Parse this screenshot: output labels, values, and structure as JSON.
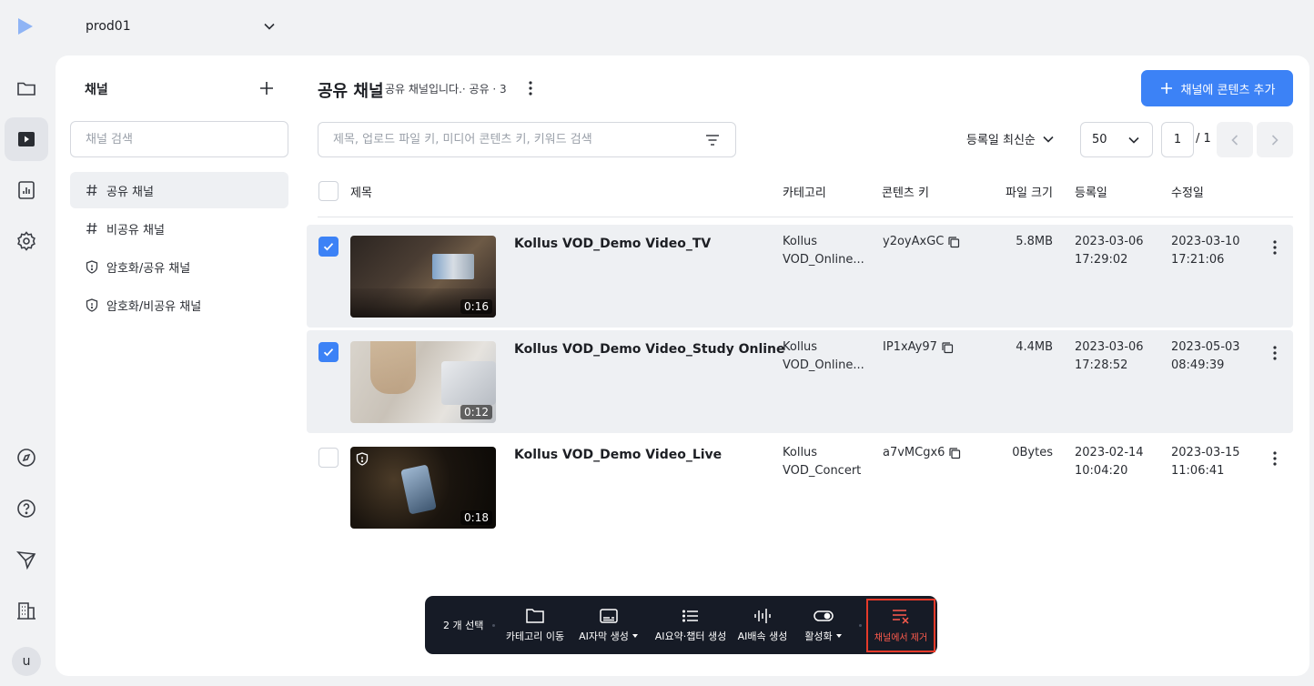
{
  "workspace": {
    "name": "prod01"
  },
  "sidebar": {
    "title": "채널",
    "search_placeholder": "채널 검색",
    "items": [
      {
        "label": "공유 채널",
        "icon": "hash-icon"
      },
      {
        "label": "비공유 채널",
        "icon": "hash-icon"
      },
      {
        "label": "암호화/공유 채널",
        "icon": "shield-icon"
      },
      {
        "label": "암호화/비공유 채널",
        "icon": "shield-icon"
      }
    ]
  },
  "header": {
    "title": "공유 채널",
    "subtitle": "공유 채널입니다.· 공유 · 3",
    "add_button": "채널에 콘텐츠 추가"
  },
  "toolbar": {
    "search_placeholder": "제목, 업로드 파일 키, 미디어 콘텐츠 키, 키워드 검색",
    "sort_label": "등록일 최신순",
    "per_page": "50",
    "page": "1",
    "page_total": "/ 1"
  },
  "table": {
    "columns": {
      "title": "제목",
      "category": "카테고리",
      "key": "콘텐츠 키",
      "size": "파일 크기",
      "created": "등록일",
      "modified": "수정일"
    },
    "rows": [
      {
        "title": "Kollus VOD_Demo Video_TV",
        "duration": "0:16",
        "category1": "Kollus",
        "category2": "VOD_Online...",
        "key": "y2oyAxGC",
        "size": "5.8MB",
        "created1": "2023-03-06",
        "created2": "17:29:02",
        "modified1": "2023-03-10",
        "modified2": "17:21:06",
        "checked": true
      },
      {
        "title": "Kollus VOD_Demo Video_Study Online",
        "duration": "0:12",
        "category1": "Kollus",
        "category2": "VOD_Online...",
        "key": "IP1xAy97",
        "size": "4.4MB",
        "created1": "2023-03-06",
        "created2": "17:28:52",
        "modified1": "2023-05-03",
        "modified2": "08:49:39",
        "checked": true
      },
      {
        "title": "Kollus VOD_Demo Video_Live",
        "duration": "0:18",
        "category1": "Kollus",
        "category2": "VOD_Concert",
        "key": "a7vMCgx6",
        "size": "0Bytes",
        "created1": "2023-02-14",
        "created2": "10:04:20",
        "modified1": "2023-03-15",
        "modified2": "11:06:41",
        "checked": false
      }
    ]
  },
  "actionbar": {
    "selected": "2 개 선택",
    "actions": [
      {
        "label": "카테고리 이동",
        "icon": "folder-icon"
      },
      {
        "label": "AI자막 생성",
        "icon": "subtitle-icon"
      },
      {
        "label": "AI요약·챕터 생성",
        "icon": "list-icon"
      },
      {
        "label": "AI배속 생성",
        "icon": "waveform-icon"
      },
      {
        "label": "활성화",
        "icon": "toggle-icon"
      }
    ],
    "remove_label": "채널에서 제거"
  },
  "user": {
    "initial": "u"
  },
  "colors": {
    "accent": "#3c82f6",
    "bar": "#161b26",
    "danger": "#ff5b4d"
  }
}
